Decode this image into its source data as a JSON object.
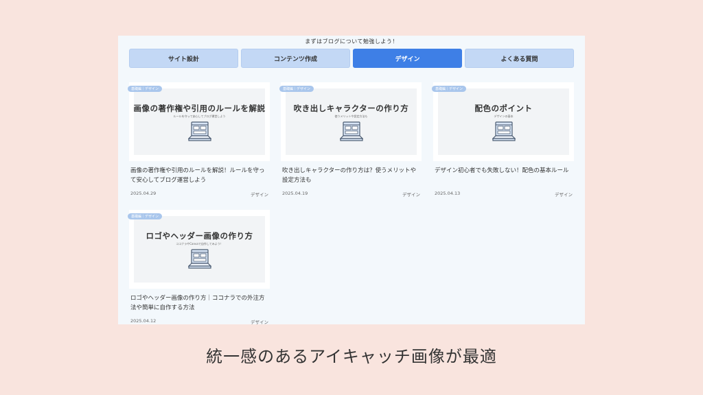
{
  "heading": "まずはブログについて勉強しよう！",
  "tabs": [
    {
      "label": "サイト設計",
      "active": false
    },
    {
      "label": "コンテンツ作成",
      "active": false
    },
    {
      "label": "デザイン",
      "active": true
    },
    {
      "label": "よくある質問",
      "active": false
    }
  ],
  "cards": [
    {
      "badge": "基礎編｜デザイン",
      "thumb_title": "画像の著作権や引用のルールを解説",
      "thumb_sub": "ルールを守って安心してブログ運営しよう",
      "title": "画像の著作権や引用のルールを解説！ルールを守って安心してブログ運営しよう",
      "date": "2025.04.29",
      "category": "デザイン"
    },
    {
      "badge": "基礎編｜デザイン",
      "thumb_title": "吹き出しキャラクターの作り方",
      "thumb_sub": "使うメリットや設定方法も",
      "title": "吹き出しキャラクターの作り方は？使うメリットや設定方法も",
      "date": "2025.04.19",
      "category": "デザイン"
    },
    {
      "badge": "基礎編｜デザイン",
      "thumb_title": "配色のポイント",
      "thumb_sub": "デザインの基本",
      "title": "デザイン初心者でも失敗しない！配色の基本ルール",
      "date": "2025.04.13",
      "category": "デザイン"
    },
    {
      "badge": "基礎編｜デザイン",
      "thumb_title": "ロゴやヘッダー画像の作り方",
      "thumb_sub": "ココナラやCanvaで自作してみよう！",
      "title": "ロゴやヘッダー画像の作り方｜ココナラでの外注方法や簡単に自作する方法",
      "date": "2025.04.12",
      "category": "デザイン"
    }
  ],
  "caption": "統一感のあるアイキャッチ画像が最適",
  "colors": {
    "page_bg": "#f9e4de",
    "panel_bg": "#f3f8fc",
    "tab_bg": "#c3d8f5",
    "tab_active": "#3e7fe6",
    "badge": "#a9c6ec"
  }
}
